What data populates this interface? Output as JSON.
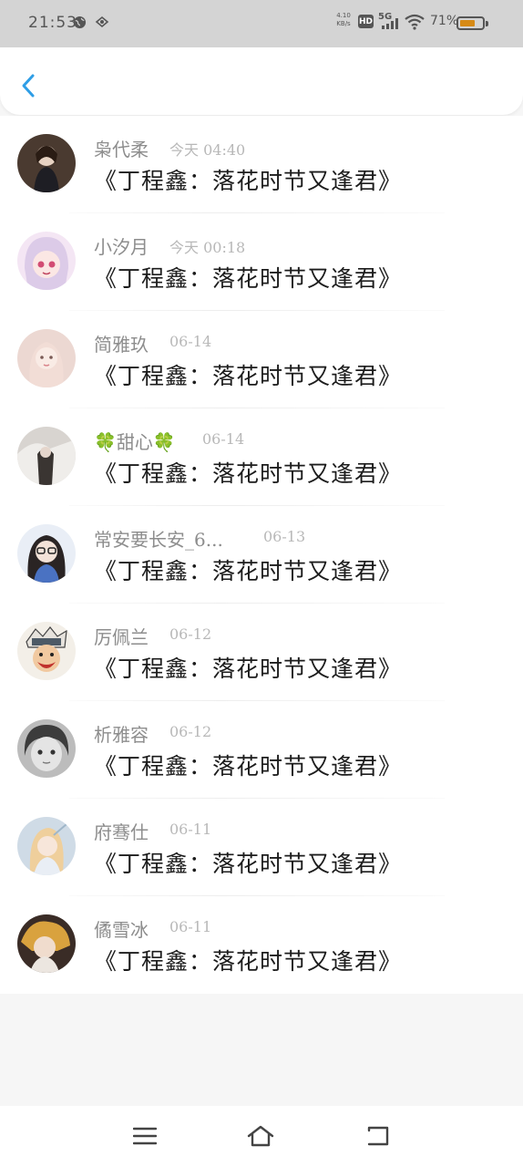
{
  "status_bar": {
    "time": "21:53",
    "net_speed_value": "4.10",
    "net_speed_unit": "KB/s",
    "hd": "HD",
    "network": "5G",
    "battery_percent": "71%",
    "battery_level": 0.71,
    "battery_color": "#d68a16"
  },
  "header": {
    "back_icon": "chevron-left-icon",
    "accent": "#2f9ee6"
  },
  "list": [
    {
      "name": "枭代柔",
      "time": "今天 04:40",
      "title": "《丁程鑫：落花时节又逢君》"
    },
    {
      "name": "小汐月",
      "time": "今天 00:18",
      "title": "《丁程鑫：落花时节又逢君》"
    },
    {
      "name": "简雅玖",
      "time": "06-14",
      "title": "《丁程鑫：落花时节又逢君》"
    },
    {
      "name": "🍀甜心🍀",
      "time": "06-14",
      "title": "《丁程鑫：落花时节又逢君》"
    },
    {
      "name": "常安要长安_6...",
      "time": "06-13",
      "title": "《丁程鑫：落花时节又逢君》"
    },
    {
      "name": "厉佩兰",
      "time": "06-12",
      "title": "《丁程鑫：落花时节又逢君》"
    },
    {
      "name": "析雅容",
      "time": "06-12",
      "title": "《丁程鑫：落花时节又逢君》"
    },
    {
      "name": "府骞仕",
      "time": "06-11",
      "title": "《丁程鑫：落花时节又逢君》"
    },
    {
      "name": "僪雪冰",
      "time": "06-11",
      "title": "《丁程鑫：落花时节又逢君》"
    }
  ],
  "nav_bar": {
    "icons": [
      "menu-icon",
      "home-icon",
      "back-icon"
    ]
  }
}
